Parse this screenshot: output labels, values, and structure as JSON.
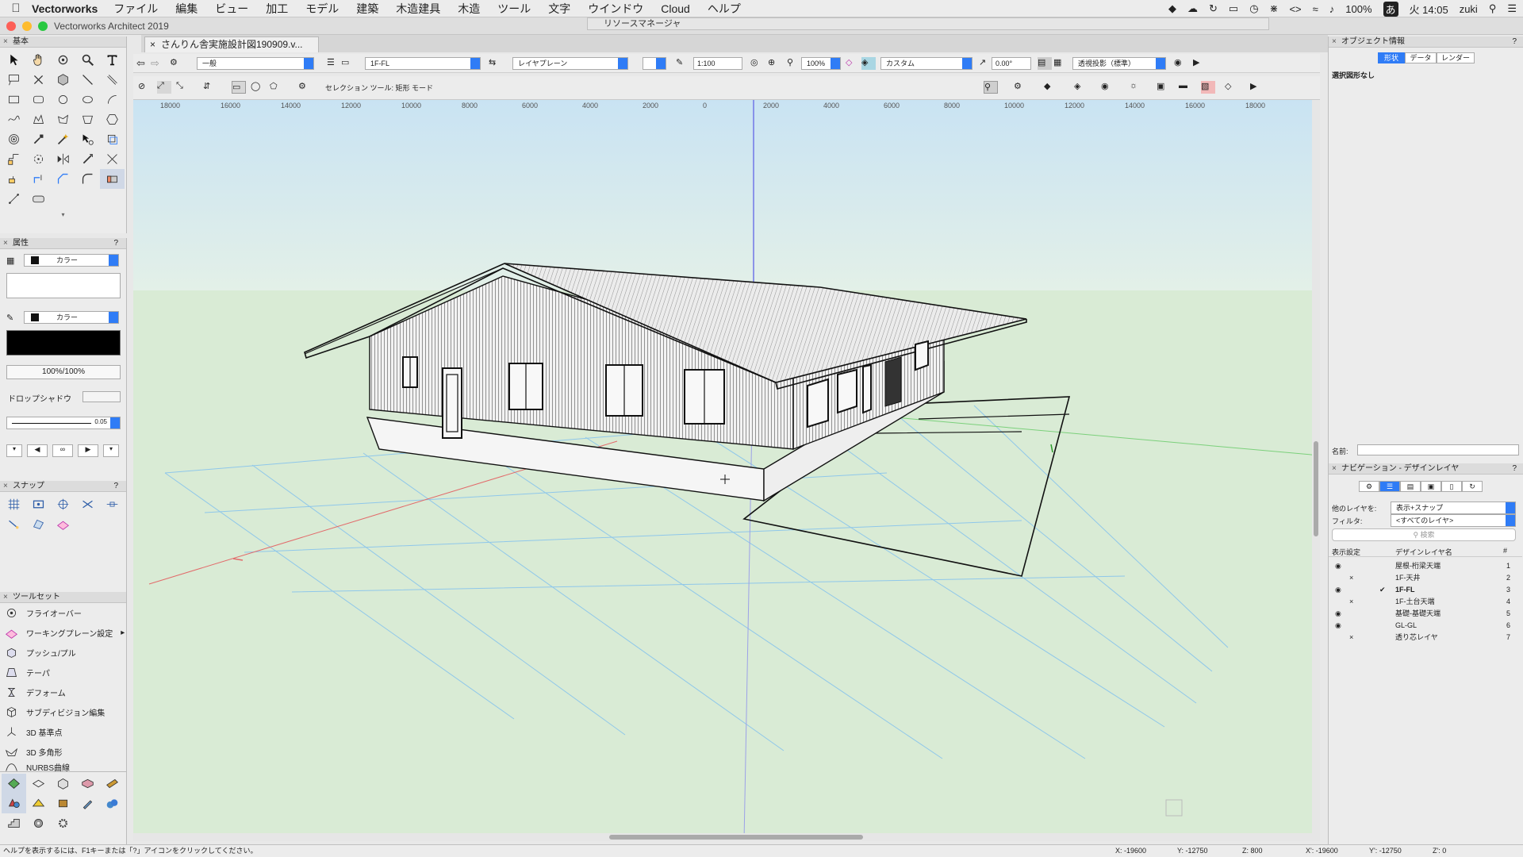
{
  "menubar": {
    "app": "Vectorworks",
    "items": [
      "ファイル",
      "編集",
      "ビュー",
      "加工",
      "モデル",
      "建築",
      "木造建具",
      "木造",
      "ツール",
      "文字",
      "ウインドウ",
      "Cloud",
      "ヘルプ"
    ],
    "battery": "100%",
    "input": "あ",
    "clock": "火 14:05",
    "user": "zuki"
  },
  "window": {
    "title": "Vectorworks Architect 2019",
    "resource_manager": "リソースマネージャ",
    "doc_tab": "さんりん舎実施設計図190909.v..."
  },
  "palettes": {
    "basic": "基本",
    "attributes": "属性",
    "snap": "スナップ",
    "toolset": "ツールセット"
  },
  "attributes": {
    "fill_label": "カラー",
    "pen_label": "カラー",
    "opacity": "100%/100%",
    "drop_shadow": "ドロップシャドウ",
    "line_weight": "0.05"
  },
  "toolset_items": [
    {
      "label": "フライオーバー",
      "icon": "flyover-icon"
    },
    {
      "label": "ワーキングプレーン設定",
      "icon": "working-plane-icon"
    },
    {
      "label": "プッシュ/プル",
      "icon": "push-pull-icon"
    },
    {
      "label": "テーパ",
      "icon": "taper-icon"
    },
    {
      "label": "デフォーム",
      "icon": "deform-icon"
    },
    {
      "label": "サブディビジョン編集",
      "icon": "subdivision-icon"
    },
    {
      "label": "3D 基準点",
      "icon": "3d-locus-icon"
    },
    {
      "label": "3D 多角形",
      "icon": "3d-polygon-icon"
    },
    {
      "label": "NURBS曲線",
      "icon": "nurbs-curve-icon"
    }
  ],
  "view_bar": {
    "class": "一般",
    "layer": "1F-FL",
    "plane": "レイヤプレーン",
    "scale": "1:100",
    "zoom": "100%",
    "view": "カスタム",
    "rotation": "0.00°",
    "projection": "透視投影（標準）"
  },
  "tool_bar": {
    "mode_text": "セレクション ツール: 矩形 モード"
  },
  "ruler": {
    "ticks": [
      "18000",
      "16000",
      "14000",
      "12000",
      "10000",
      "8000",
      "6000",
      "4000",
      "2000",
      "0",
      "2000",
      "4000",
      "6000",
      "8000",
      "10000",
      "12000",
      "14000",
      "16000",
      "18000"
    ]
  },
  "obj_info": {
    "title": "オブジェクト情報",
    "tabs": [
      "形状",
      "データ",
      "レンダー"
    ],
    "selection": "選択図形なし",
    "name_label": "名前:"
  },
  "navigation": {
    "title": "ナビゲーション - デザインレイヤ",
    "other_layers_label": "他のレイヤを:",
    "other_layers_value": "表示+スナップ",
    "filter_label": "フィルタ:",
    "filter_value": "<すべてのレイヤ>",
    "search_placeholder": "検索",
    "col_visibility": "表示設定",
    "col_name": "デザインレイヤ名",
    "col_num": "#",
    "layers": [
      {
        "name": "屋根-桁梁天端",
        "num": "1",
        "vis": "eye",
        "active": false
      },
      {
        "name": "1F-天井",
        "num": "2",
        "vis": "x",
        "active": false
      },
      {
        "name": "1F-FL",
        "num": "3",
        "vis": "eye",
        "active": true
      },
      {
        "name": "1F-土台天端",
        "num": "4",
        "vis": "x",
        "active": false
      },
      {
        "name": "基礎-基礎天端",
        "num": "5",
        "vis": "eye",
        "active": false
      },
      {
        "name": "GL-GL",
        "num": "6",
        "vis": "eye",
        "active": false
      },
      {
        "name": "透り芯レイヤ",
        "num": "7",
        "vis": "x",
        "active": false
      }
    ]
  },
  "status": {
    "help": "ヘルプを表示するには、F1キーまたは「?」アイコンをクリックしてください。",
    "x": "X: -19600",
    "y": "Y: -12750",
    "z": "Z: 800",
    "x2": "X': -19600",
    "y2": "Y': -12750",
    "z2": "Z': 0"
  }
}
